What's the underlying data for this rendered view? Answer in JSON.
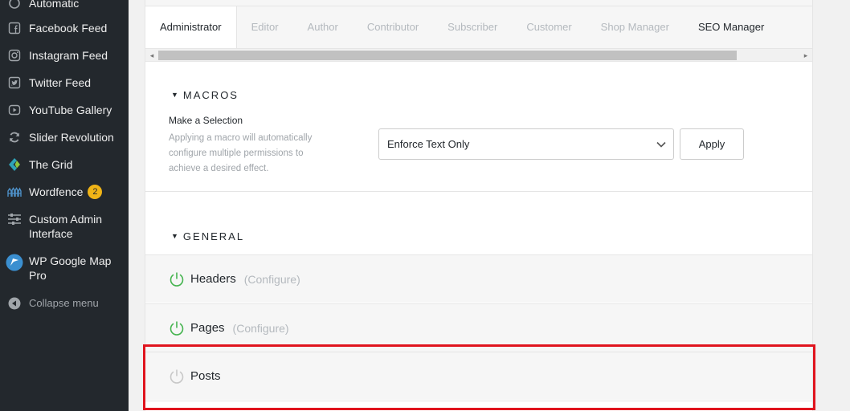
{
  "sidebar": {
    "items": [
      {
        "label": "Automatic",
        "icon": "automatic-icon"
      },
      {
        "label": "Facebook Feed",
        "icon": "facebook-icon"
      },
      {
        "label": "Instagram Feed",
        "icon": "instagram-icon"
      },
      {
        "label": "Twitter Feed",
        "icon": "twitter-icon"
      },
      {
        "label": "YouTube Gallery",
        "icon": "youtube-icon"
      },
      {
        "label": "Slider Revolution",
        "icon": "refresh-icon"
      },
      {
        "label": "The Grid",
        "icon": "the-grid-icon"
      },
      {
        "label": "Wordfence",
        "icon": "wordfence-icon",
        "badge": "2"
      },
      {
        "label": "Custom Admin Interface",
        "icon": "sliders-icon"
      },
      {
        "label": "WP Google Map Pro",
        "icon": "map-pin-icon"
      }
    ],
    "collapse_label": "Collapse menu",
    "badge_color": "#f0b417"
  },
  "tabs": [
    "Administrator",
    "Editor",
    "Author",
    "Contributor",
    "Subscriber",
    "Customer",
    "Shop Manager",
    "SEO Manager"
  ],
  "macros": {
    "title": "MACROS",
    "label": "Make a Selection",
    "description": "Applying a macro will automatically configure multiple permissions to achieve a desired effect.",
    "selected": "Enforce Text Only",
    "apply_label": "Apply"
  },
  "general": {
    "title": "GENERAL",
    "rows": [
      {
        "name": "Headers",
        "configure": "(Configure)",
        "enabled": true
      },
      {
        "name": "Pages",
        "configure": "(Configure)",
        "enabled": true
      },
      {
        "name": "Posts",
        "configure": "",
        "enabled": false
      }
    ]
  },
  "colors": {
    "sidebar_bg": "#23282d",
    "power_on": "#46b450",
    "power_off": "#c8c8c8",
    "highlight": "#e0141e"
  }
}
